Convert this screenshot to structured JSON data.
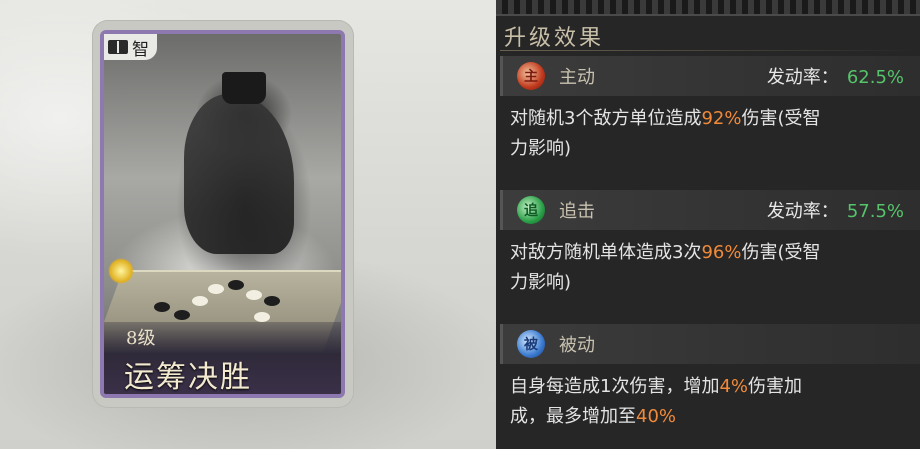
{
  "card": {
    "type_label": "智",
    "level": "8级",
    "name": "运筹决胜"
  },
  "panel": {
    "title": "升级效果",
    "skills": [
      {
        "icon": "主",
        "type": "主动",
        "rate_label": "发动率：",
        "rate": "62.5%",
        "desc_a": "对随机3个敌方单位造成",
        "desc_hl": "92%",
        "desc_b": "伤害(受智",
        "desc_c": "力影响)"
      },
      {
        "icon": "追",
        "type": "追击",
        "rate_label": "发动率：",
        "rate": "57.5%",
        "desc_a": "对敌方随机单体造成3次",
        "desc_hl": "96%",
        "desc_b": "伤害(受智",
        "desc_c": "力影响)"
      },
      {
        "icon": "被",
        "type": "被动",
        "desc_a": "自身每造成1次伤害，增加",
        "desc_hl": "4%",
        "desc_b": "伤害加",
        "desc_c": "成，最多增加至",
        "desc_hl2": "40%"
      }
    ]
  },
  "colors": {
    "highlight": "#f08a3a",
    "rate": "#56c46a",
    "card_border": "#8e78b0",
    "panel_bg": "#262626"
  }
}
